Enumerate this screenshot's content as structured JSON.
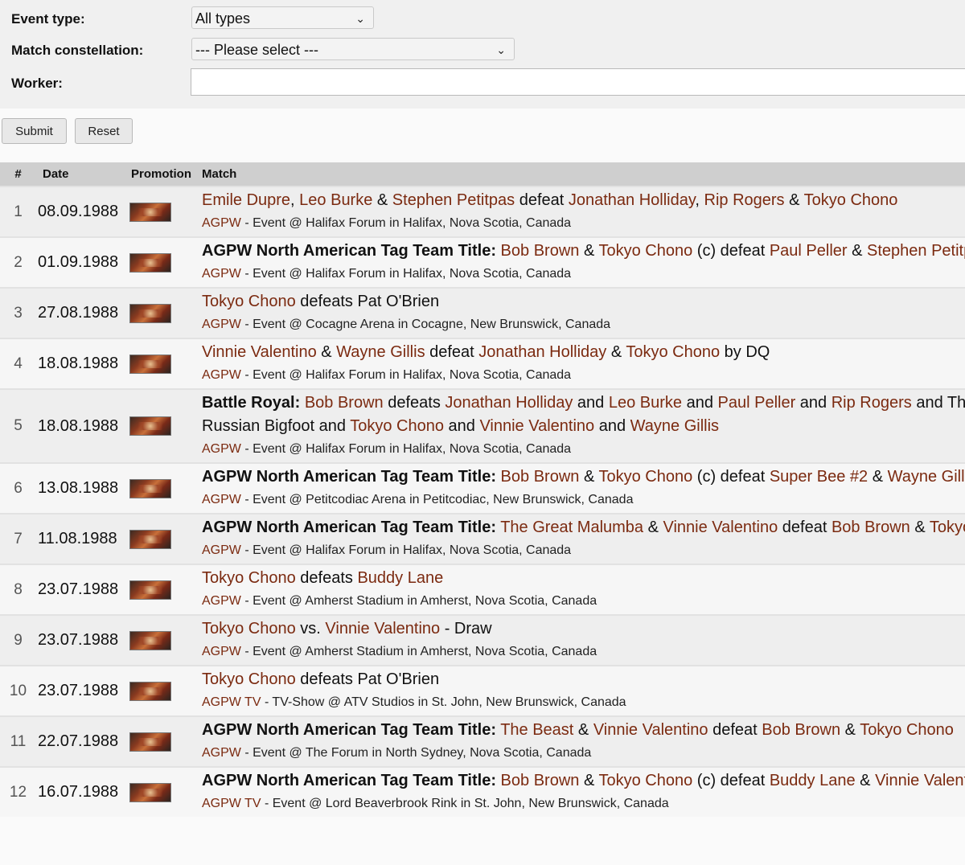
{
  "filters": {
    "event_type_label": "Event type:",
    "event_type_value": "All types",
    "constellation_label": "Match constellation:",
    "constellation_value": "--- Please select ---",
    "worker_label": "Worker:",
    "worker_value": ""
  },
  "buttons": {
    "submit": "Submit",
    "reset": "Reset"
  },
  "table": {
    "headers": {
      "num": "#",
      "date": "Date",
      "promotion": "Promotion",
      "match": "Match"
    },
    "rows": [
      {
        "num": "1",
        "date": "08.09.1988",
        "match": [
          [
            "l",
            "Emile Dupre"
          ],
          [
            "t",
            ", "
          ],
          [
            "l",
            "Leo Burke"
          ],
          [
            "t",
            " & "
          ],
          [
            "l",
            "Stephen Petitpas"
          ],
          [
            "t",
            " defeat "
          ],
          [
            "l",
            "Jonathan Holliday"
          ],
          [
            "t",
            ", "
          ],
          [
            "l",
            "Rip Rogers"
          ],
          [
            "t",
            " & "
          ],
          [
            "l",
            "Tokyo Chono"
          ]
        ],
        "event": [
          [
            "l",
            "AGPW"
          ],
          [
            "t",
            " - Event @ Halifax Forum in Halifax, Nova Scotia, Canada"
          ]
        ]
      },
      {
        "num": "2",
        "date": "01.09.1988",
        "match": [
          [
            "b",
            "AGPW North American Tag Team Title:"
          ],
          [
            "t",
            " "
          ],
          [
            "l",
            "Bob Brown"
          ],
          [
            "t",
            " & "
          ],
          [
            "l",
            "Tokyo Chono"
          ],
          [
            "t",
            " (c) defeat "
          ],
          [
            "l",
            "Paul Peller"
          ],
          [
            "t",
            " & "
          ],
          [
            "l",
            "Stephen Petitpas"
          ]
        ],
        "event": [
          [
            "l",
            "AGPW"
          ],
          [
            "t",
            " - Event @ Halifax Forum in Halifax, Nova Scotia, Canada"
          ]
        ]
      },
      {
        "num": "3",
        "date": "27.08.1988",
        "match": [
          [
            "l",
            "Tokyo Chono"
          ],
          [
            "t",
            " defeats Pat O'Brien"
          ]
        ],
        "event": [
          [
            "l",
            "AGPW"
          ],
          [
            "t",
            " - Event @ Cocagne Arena in Cocagne, New Brunswick, Canada"
          ]
        ]
      },
      {
        "num": "4",
        "date": "18.08.1988",
        "match": [
          [
            "l",
            "Vinnie Valentino"
          ],
          [
            "t",
            " & "
          ],
          [
            "l",
            "Wayne Gillis"
          ],
          [
            "t",
            " defeat "
          ],
          [
            "l",
            "Jonathan Holliday"
          ],
          [
            "t",
            " & "
          ],
          [
            "l",
            "Tokyo Chono"
          ],
          [
            "t",
            " by DQ"
          ]
        ],
        "event": [
          [
            "l",
            "AGPW"
          ],
          [
            "t",
            " - Event @ Halifax Forum in Halifax, Nova Scotia, Canada"
          ]
        ]
      },
      {
        "num": "5",
        "date": "18.08.1988",
        "wrap": true,
        "match": [
          [
            "b",
            "Battle Royal:"
          ],
          [
            "t",
            " "
          ],
          [
            "l",
            "Bob Brown"
          ],
          [
            "t",
            " defeats "
          ],
          [
            "l",
            "Jonathan Holliday"
          ],
          [
            "t",
            " and "
          ],
          [
            "l",
            "Leo Burke"
          ],
          [
            "t",
            " and "
          ],
          [
            "l",
            "Paul Peller"
          ],
          [
            "t",
            " and "
          ],
          [
            "l",
            "Rip Rogers"
          ],
          [
            "t",
            " and The Russian Bigfoot and "
          ],
          [
            "l",
            "Tokyo Chono"
          ],
          [
            "t",
            " and "
          ],
          [
            "l",
            "Vinnie Valentino"
          ],
          [
            "t",
            " and "
          ],
          [
            "l",
            "Wayne Gillis"
          ]
        ],
        "event": [
          [
            "l",
            "AGPW"
          ],
          [
            "t",
            " - Event @ Halifax Forum in Halifax, Nova Scotia, Canada"
          ]
        ]
      },
      {
        "num": "6",
        "date": "13.08.1988",
        "match": [
          [
            "b",
            "AGPW North American Tag Team Title:"
          ],
          [
            "t",
            " "
          ],
          [
            "l",
            "Bob Brown"
          ],
          [
            "t",
            " & "
          ],
          [
            "l",
            "Tokyo Chono"
          ],
          [
            "t",
            " (c) defeat "
          ],
          [
            "l",
            "Super Bee #2"
          ],
          [
            "t",
            " & "
          ],
          [
            "l",
            "Wayne Gillis"
          ]
        ],
        "event": [
          [
            "l",
            "AGPW"
          ],
          [
            "t",
            " - Event @ Petitcodiac Arena in Petitcodiac, New Brunswick, Canada"
          ]
        ]
      },
      {
        "num": "7",
        "date": "11.08.1988",
        "match": [
          [
            "b",
            "AGPW North American Tag Team Title:"
          ],
          [
            "t",
            " "
          ],
          [
            "l",
            "The Great Malumba"
          ],
          [
            "t",
            " & "
          ],
          [
            "l",
            "Vinnie Valentino"
          ],
          [
            "t",
            " defeat "
          ],
          [
            "l",
            "Bob Brown"
          ],
          [
            "t",
            " & "
          ],
          [
            "l",
            "Tokyo Chono"
          ]
        ],
        "event": [
          [
            "l",
            "AGPW"
          ],
          [
            "t",
            " - Event @ Halifax Forum in Halifax, Nova Scotia, Canada"
          ]
        ]
      },
      {
        "num": "8",
        "date": "23.07.1988",
        "match": [
          [
            "l",
            "Tokyo Chono"
          ],
          [
            "t",
            " defeats "
          ],
          [
            "l",
            "Buddy Lane"
          ]
        ],
        "event": [
          [
            "l",
            "AGPW"
          ],
          [
            "t",
            " - Event @ Amherst Stadium in Amherst, Nova Scotia, Canada"
          ]
        ]
      },
      {
        "num": "9",
        "date": "23.07.1988",
        "match": [
          [
            "l",
            "Tokyo Chono"
          ],
          [
            "t",
            " vs. "
          ],
          [
            "l",
            "Vinnie Valentino"
          ],
          [
            "t",
            " - Draw"
          ]
        ],
        "event": [
          [
            "l",
            "AGPW"
          ],
          [
            "t",
            " - Event @ Amherst Stadium in Amherst, Nova Scotia, Canada"
          ]
        ]
      },
      {
        "num": "10",
        "date": "23.07.1988",
        "match": [
          [
            "l",
            "Tokyo Chono"
          ],
          [
            "t",
            " defeats Pat O'Brien"
          ]
        ],
        "event": [
          [
            "l",
            "AGPW TV"
          ],
          [
            "t",
            " - TV-Show @ ATV Studios in St. John, New Brunswick, Canada"
          ]
        ]
      },
      {
        "num": "11",
        "date": "22.07.1988",
        "match": [
          [
            "b",
            "AGPW North American Tag Team Title:"
          ],
          [
            "t",
            " "
          ],
          [
            "l",
            "The Beast"
          ],
          [
            "t",
            " & "
          ],
          [
            "l",
            "Vinnie Valentino"
          ],
          [
            "t",
            " defeat "
          ],
          [
            "l",
            "Bob Brown"
          ],
          [
            "t",
            " & "
          ],
          [
            "l",
            "Tokyo Chono"
          ]
        ],
        "event": [
          [
            "l",
            "AGPW"
          ],
          [
            "t",
            " - Event @ The Forum in North Sydney, Nova Scotia, Canada"
          ]
        ]
      },
      {
        "num": "12",
        "date": "16.07.1988",
        "match": [
          [
            "b",
            "AGPW North American Tag Team Title:"
          ],
          [
            "t",
            " "
          ],
          [
            "l",
            "Bob Brown"
          ],
          [
            "t",
            " & "
          ],
          [
            "l",
            "Tokyo Chono"
          ],
          [
            "t",
            " (c) defeat "
          ],
          [
            "l",
            "Buddy Lane"
          ],
          [
            "t",
            " & "
          ],
          [
            "l",
            "Vinnie Valentino"
          ]
        ],
        "event": [
          [
            "l",
            "AGPW TV"
          ],
          [
            "t",
            " - Event @ Lord Beaverbrook Rink in St. John, New Brunswick, Canada"
          ]
        ]
      }
    ]
  },
  "icons": {
    "select_arrow": "chevron-down-icon",
    "promotion_logo": "agpw-logo-icon"
  },
  "colors": {
    "link": "#7b2a10",
    "row_odd": "#eeeeee",
    "row_even": "#f6f6f6",
    "header_bg": "#cfcfcf"
  }
}
